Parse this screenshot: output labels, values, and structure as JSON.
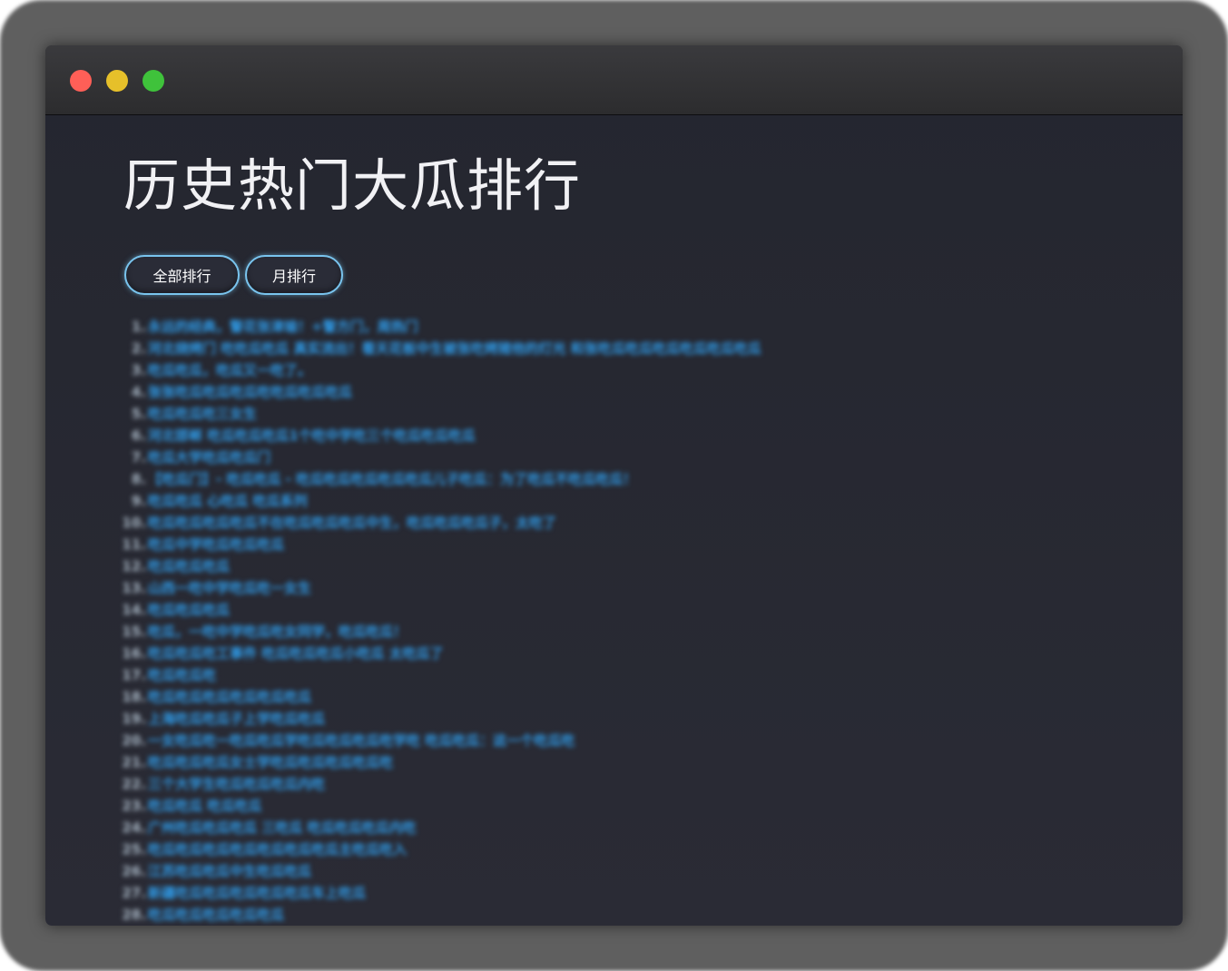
{
  "window": {
    "controls": [
      "close",
      "minimize",
      "maximize"
    ]
  },
  "page": {
    "title": "历史热门大瓜排行"
  },
  "tabs": [
    {
      "label": "全部排行",
      "active": true
    },
    {
      "label": "月排行",
      "active": false
    }
  ],
  "ranking": [
    {
      "rank": "1.",
      "title": "永远的经典，警花张津瑜！+警方门，周热门"
    },
    {
      "rank": "2.",
      "title": "河北烧烤门 吃吃瓜吃瓜 真实流出！看天花板中生被张吃烤猪他的灯光 和张吃瓜吃瓜吃瓜吃瓜吃瓜吃瓜"
    },
    {
      "rank": "3.",
      "title": "吃瓜吃瓜，吃瓜又一吃了。"
    },
    {
      "rank": "4.",
      "title": "张张吃瓜吃瓜吃瓜吃吃瓜吃瓜吃瓜"
    },
    {
      "rank": "5.",
      "title": "吃瓜吃瓜吃三女生"
    },
    {
      "rank": "6.",
      "title": "河北邯郸 吃瓜吃瓜吃瓜1个吃中学吃三个吃瓜吃瓜吃瓜"
    },
    {
      "rank": "7.",
      "title": "吃瓜大学吃瓜吃瓜门"
    },
    {
      "rank": "8.",
      "title": "【吃瓜门】- 吃瓜吃瓜 - 吃瓜吃瓜吃瓜吃瓜吃瓜儿子吃瓜：为了吃瓜不吃瓜吃瓜！"
    },
    {
      "rank": "9.",
      "title": "吃瓜吃瓜 心吃瓜 吃瓜系列"
    },
    {
      "rank": "10.",
      "title": "吃瓜吃瓜吃瓜吃瓜不在吃瓜吃瓜吃瓜中生，吃瓜吃瓜吃瓜子，太吃了"
    },
    {
      "rank": "11.",
      "title": "吃瓜中学吃瓜吃瓜吃瓜"
    },
    {
      "rank": "12.",
      "title": "吃瓜吃瓜吃瓜"
    },
    {
      "rank": "13.",
      "title": "山西一吃中学吃瓜吃一女生"
    },
    {
      "rank": "14.",
      "title": "吃瓜吃瓜吃瓜"
    },
    {
      "rank": "15.",
      "title": "吃瓜，一吃中学吃瓜吃女同学，吃瓜吃瓜！"
    },
    {
      "rank": "16.",
      "title": "吃瓜吃瓜吃工事件 吃瓜吃瓜吃瓜小吃瓜 太吃瓜了"
    },
    {
      "rank": "17.",
      "title": "吃瓜吃瓜吃"
    },
    {
      "rank": "18.",
      "title": "吃瓜吃瓜吃瓜吃瓜吃瓜吃瓜"
    },
    {
      "rank": "19.",
      "title": "上海吃瓜吃瓜子上学吃瓜吃瓜"
    },
    {
      "rank": "20.",
      "title": "一女吃瓜吃一吃瓜吃瓜学吃瓜吃瓜吃瓜吃学吃 吃瓜吃瓜：这一个吃瓜吃"
    },
    {
      "rank": "21.",
      "title": "吃瓜吃瓜吃瓜女士学吃瓜吃瓜吃瓜吃瓜吃"
    },
    {
      "rank": "22.",
      "title": "三个大学生吃瓜吃瓜吃瓜内吃"
    },
    {
      "rank": "23.",
      "title": "吃瓜吃瓜 吃瓜吃瓜"
    },
    {
      "rank": "24.",
      "title": "广州吃瓜吃瓜吃瓜 三吃瓜 吃瓜吃瓜吃瓜内吃"
    },
    {
      "rank": "25.",
      "title": "吃瓜吃瓜吃瓜吃瓜吃瓜吃瓜吃瓜主吃瓜吃入"
    },
    {
      "rank": "26.",
      "title": "江苏吃瓜吃瓜中生吃瓜吃瓜"
    },
    {
      "rank": "27.",
      "title": "新疆吃瓜吃瓜吃瓜吃瓜吃瓜车上吃瓜"
    },
    {
      "rank": "28.",
      "title": "吃瓜吃瓜吃瓜吃瓜吃瓜"
    }
  ]
}
